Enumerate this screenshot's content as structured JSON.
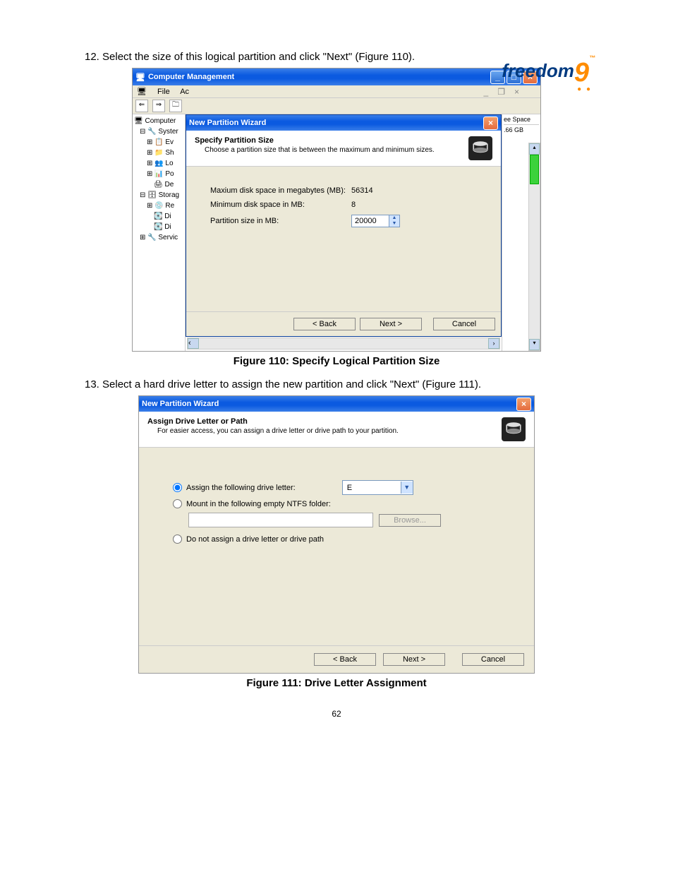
{
  "logo": {
    "brand": "freedom",
    "accent": "9",
    "tm": "™"
  },
  "step12": "12. Select the size of this logical partition and click \"Next\" (Figure 110).",
  "step13": "13. Select a hard drive letter to assign the new partition and click \"Next\" (Figure 111).",
  "caption1": "Figure 110: Specify Logical Partition Size",
  "caption2": "Figure 111: Drive Letter Assignment",
  "pagenum": "62",
  "sh1": {
    "parentTitle": "Computer Management",
    "menu": {
      "file": "File",
      "action": "Ac"
    },
    "tree": {
      "root": "Computer",
      "system": "Syster",
      "ev": "Ev",
      "sh": "Sh",
      "lo": "Lo",
      "po": "Po",
      "de": "De",
      "storage": "Storag",
      "re": "Re",
      "di1": "Di",
      "di2": "Di",
      "services": "Servic"
    },
    "right": {
      "header": "ee Space",
      "value": ".66 GB"
    },
    "wizard": {
      "title": "New Partition Wizard",
      "hdrTitle": "Specify Partition Size",
      "hdrSub": "Choose a partition size that is between the maximum and minimum sizes.",
      "maxLabel": "Maxium disk space in megabytes (MB):",
      "maxValue": "56314",
      "minLabel": "Minimum disk space in MB:",
      "minValue": "8",
      "sizeLabel": "Partition size in MB:",
      "sizeValue": "20000",
      "back": "< Back",
      "next": "Next >",
      "cancel": "Cancel"
    }
  },
  "sh2": {
    "title": "New Partition Wizard",
    "hdrTitle": "Assign Drive Letter or Path",
    "hdrSub": "For easier access, you can assign a drive letter or drive path to your partition.",
    "opt1": "Assign the following drive letter:",
    "drive": "E",
    "opt2": "Mount in the following empty NTFS folder:",
    "browse": "Browse...",
    "opt3": "Do not assign a drive letter or drive path",
    "back": "< Back",
    "next": "Next >",
    "cancel": "Cancel"
  }
}
